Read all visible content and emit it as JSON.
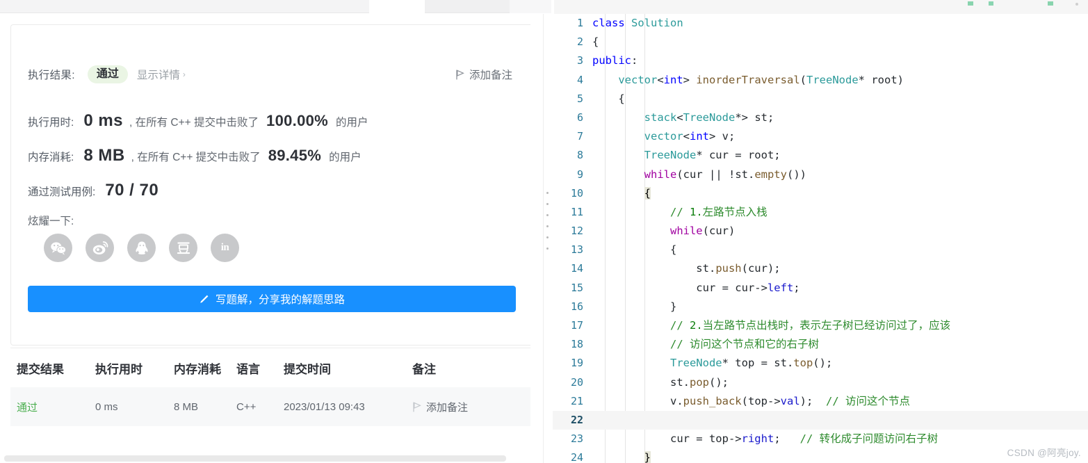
{
  "result_card": {
    "result_label": "执行结果:",
    "status_badge": "通过",
    "detail_link": "显示详情",
    "detail_caret": "›",
    "add_note": "添加备注",
    "runtime_label": "执行用时:",
    "runtime_value": "0 ms",
    "runtime_mid": ", 在所有 C++ 提交中击败了",
    "runtime_pct": "100.00%",
    "runtime_tail": "的用户",
    "memory_label": "内存消耗:",
    "memory_value": "8 MB",
    "memory_mid": ", 在所有 C++ 提交中击败了",
    "memory_pct": "89.45%",
    "memory_tail": "的用户",
    "testcase_label": "通过测试用例:",
    "testcase_value": "70 / 70",
    "share_label": "炫耀一下:",
    "share_icons": [
      {
        "name": "wechat-icon",
        "title": "WeChat"
      },
      {
        "name": "weibo-icon",
        "title": "Weibo"
      },
      {
        "name": "qq-icon",
        "title": "QQ"
      },
      {
        "name": "douban-icon",
        "title": "Douban"
      },
      {
        "name": "linkedin-icon",
        "title": "in"
      }
    ],
    "write_button": "写题解，分享我的解题思路"
  },
  "submissions_table": {
    "headers": [
      "提交结果",
      "执行用时",
      "内存消耗",
      "语言",
      "提交时间",
      "备注"
    ],
    "rows": [
      {
        "status": "通过",
        "runtime": "0 ms",
        "memory": "8 MB",
        "language": "C++",
        "time": "2023/01/13 09:43",
        "note": "添加备注"
      }
    ]
  },
  "editor": {
    "active_line": 22,
    "total_lines": 24,
    "lines": [
      {
        "n": 1,
        "tokens": [
          {
            "t": "class",
            "c": "kw"
          },
          {
            "t": " ",
            "c": "pl"
          },
          {
            "t": "Solution",
            "c": "typ"
          }
        ]
      },
      {
        "n": 2,
        "tokens": [
          {
            "t": "{",
            "c": "pl"
          }
        ]
      },
      {
        "n": 3,
        "tokens": [
          {
            "t": "public",
            "c": "kw"
          },
          {
            "t": ":",
            "c": "pl"
          }
        ]
      },
      {
        "n": 4,
        "tokens": [
          {
            "t": "    ",
            "c": "pl"
          },
          {
            "t": "vector",
            "c": "typ"
          },
          {
            "t": "<",
            "c": "pl"
          },
          {
            "t": "int",
            "c": "kw"
          },
          {
            "t": "> ",
            "c": "pl"
          },
          {
            "t": "inorderTraversal",
            "c": "fn"
          },
          {
            "t": "(",
            "c": "pl"
          },
          {
            "t": "TreeNode",
            "c": "typ"
          },
          {
            "t": "* root)",
            "c": "pl"
          }
        ]
      },
      {
        "n": 5,
        "tokens": [
          {
            "t": "    {",
            "c": "pl"
          }
        ]
      },
      {
        "n": 6,
        "tokens": [
          {
            "t": "        ",
            "c": "pl"
          },
          {
            "t": "stack",
            "c": "typ"
          },
          {
            "t": "<",
            "c": "pl"
          },
          {
            "t": "TreeNode",
            "c": "typ"
          },
          {
            "t": "*> st;",
            "c": "pl"
          }
        ]
      },
      {
        "n": 7,
        "tokens": [
          {
            "t": "        ",
            "c": "pl"
          },
          {
            "t": "vector",
            "c": "typ"
          },
          {
            "t": "<",
            "c": "pl"
          },
          {
            "t": "int",
            "c": "kw"
          },
          {
            "t": "> v;",
            "c": "pl"
          }
        ]
      },
      {
        "n": 8,
        "tokens": [
          {
            "t": "        ",
            "c": "pl"
          },
          {
            "t": "TreeNode",
            "c": "typ"
          },
          {
            "t": "* cur = root;",
            "c": "pl"
          }
        ]
      },
      {
        "n": 9,
        "tokens": [
          {
            "t": "        ",
            "c": "pl"
          },
          {
            "t": "while",
            "c": "kw2"
          },
          {
            "t": "(cur || !st.",
            "c": "pl"
          },
          {
            "t": "empty",
            "c": "fn"
          },
          {
            "t": "())",
            "c": "pl"
          }
        ]
      },
      {
        "n": 10,
        "tokens": [
          {
            "t": "        ",
            "c": "pl"
          },
          {
            "t": "{",
            "c": "brk"
          }
        ]
      },
      {
        "n": 11,
        "tokens": [
          {
            "t": "            ",
            "c": "pl"
          },
          {
            "t": "// ",
            "c": "cmt"
          },
          {
            "t": "1.",
            "c": "num"
          },
          {
            "t": "左路节点入栈",
            "c": "cmt"
          }
        ]
      },
      {
        "n": 12,
        "tokens": [
          {
            "t": "            ",
            "c": "pl"
          },
          {
            "t": "while",
            "c": "kw2"
          },
          {
            "t": "(cur)",
            "c": "pl"
          }
        ]
      },
      {
        "n": 13,
        "tokens": [
          {
            "t": "            {",
            "c": "pl"
          }
        ]
      },
      {
        "n": 14,
        "tokens": [
          {
            "t": "                st.",
            "c": "pl"
          },
          {
            "t": "push",
            "c": "fn"
          },
          {
            "t": "(cur);",
            "c": "pl"
          }
        ]
      },
      {
        "n": 15,
        "tokens": [
          {
            "t": "                cur = cur->",
            "c": "pl"
          },
          {
            "t": "left",
            "c": "mem"
          },
          {
            "t": ";",
            "c": "pl"
          }
        ]
      },
      {
        "n": 16,
        "tokens": [
          {
            "t": "            }",
            "c": "pl"
          }
        ]
      },
      {
        "n": 17,
        "tokens": [
          {
            "t": "            ",
            "c": "pl"
          },
          {
            "t": "// ",
            "c": "cmt"
          },
          {
            "t": "2.",
            "c": "num"
          },
          {
            "t": "当左路节点出栈时，表示左子树已经访问过了，应该",
            "c": "cmt"
          }
        ]
      },
      {
        "n": 18,
        "tokens": [
          {
            "t": "            ",
            "c": "pl"
          },
          {
            "t": "// 访问这个节点和它的右子树",
            "c": "cmt"
          }
        ]
      },
      {
        "n": 19,
        "tokens": [
          {
            "t": "            ",
            "c": "pl"
          },
          {
            "t": "TreeNode",
            "c": "typ"
          },
          {
            "t": "* top = st.",
            "c": "pl"
          },
          {
            "t": "top",
            "c": "fn"
          },
          {
            "t": "();",
            "c": "pl"
          }
        ]
      },
      {
        "n": 20,
        "tokens": [
          {
            "t": "            st.",
            "c": "pl"
          },
          {
            "t": "pop",
            "c": "fn"
          },
          {
            "t": "();",
            "c": "pl"
          }
        ]
      },
      {
        "n": 21,
        "tokens": [
          {
            "t": "            v.",
            "c": "pl"
          },
          {
            "t": "push_back",
            "c": "fn"
          },
          {
            "t": "(top->",
            "c": "pl"
          },
          {
            "t": "val",
            "c": "mem"
          },
          {
            "t": ");  ",
            "c": "pl"
          },
          {
            "t": "// 访问这个节点",
            "c": "cmt"
          }
        ]
      },
      {
        "n": 22,
        "tokens": [
          {
            "t": "",
            "c": "pl"
          }
        ]
      },
      {
        "n": 23,
        "tokens": [
          {
            "t": "            cur = top->",
            "c": "pl"
          },
          {
            "t": "right",
            "c": "mem"
          },
          {
            "t": ";   ",
            "c": "pl"
          },
          {
            "t": "// 转化成子问题访问右子树",
            "c": "cmt"
          }
        ]
      },
      {
        "n": 24,
        "tokens": [
          {
            "t": "        ",
            "c": "pl"
          },
          {
            "t": "}",
            "c": "brk"
          }
        ]
      }
    ]
  },
  "watermark": "CSDN @阿亮joy."
}
